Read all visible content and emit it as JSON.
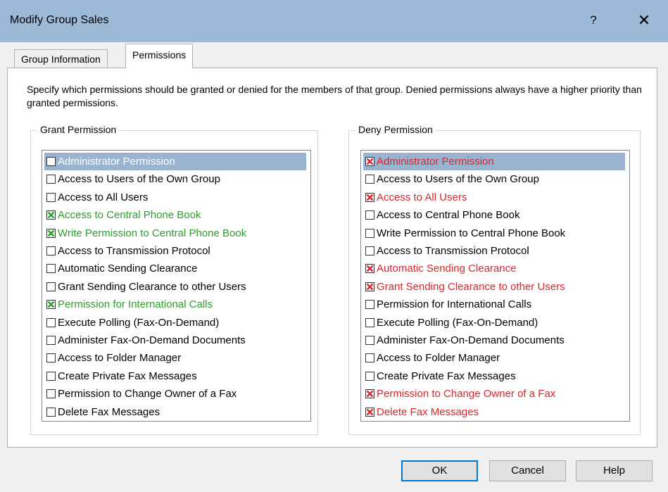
{
  "window": {
    "title": "Modify Group Sales",
    "help_glyph": "?",
    "close_glyph": "✕"
  },
  "tabs": [
    {
      "label": "Group Information",
      "active": false
    },
    {
      "label": "Permissions",
      "active": true
    }
  ],
  "description": "Specify which permissions should be granted or denied for the members of that group. Denied permissions always have a higher priority than granted permissions.",
  "grant": {
    "title": "Grant Permission",
    "items": [
      {
        "label": "Administrator Permission",
        "checked": false,
        "selected": true
      },
      {
        "label": "Access to Users of the Own Group",
        "checked": false
      },
      {
        "label": "Access to All Users",
        "checked": false
      },
      {
        "label": "Access to Central Phone Book",
        "checked": true
      },
      {
        "label": "Write Permission to Central Phone Book",
        "checked": true
      },
      {
        "label": "Access to Transmission Protocol",
        "checked": false
      },
      {
        "label": "Automatic Sending Clearance",
        "checked": false
      },
      {
        "label": "Grant Sending Clearance to other Users",
        "checked": false
      },
      {
        "label": "Permission for International Calls",
        "checked": true
      },
      {
        "label": "Execute Polling (Fax-On-Demand)",
        "checked": false
      },
      {
        "label": "Administer Fax-On-Demand Documents",
        "checked": false
      },
      {
        "label": "Access to Folder Manager",
        "checked": false
      },
      {
        "label": "Create Private Fax Messages",
        "checked": false
      },
      {
        "label": "Permission to Change Owner of a Fax",
        "checked": false
      },
      {
        "label": "Delete Fax Messages",
        "checked": false
      }
    ]
  },
  "deny": {
    "title": "Deny Permission",
    "items": [
      {
        "label": "Administrator Permission",
        "checked": true,
        "selected": true
      },
      {
        "label": "Access to Users of the Own Group",
        "checked": false
      },
      {
        "label": "Access to All Users",
        "checked": true
      },
      {
        "label": "Access to Central Phone Book",
        "checked": false
      },
      {
        "label": "Write Permission to Central Phone Book",
        "checked": false
      },
      {
        "label": "Access to Transmission Protocol",
        "checked": false
      },
      {
        "label": "Automatic Sending Clearance",
        "checked": true
      },
      {
        "label": "Grant Sending Clearance to other Users",
        "checked": true
      },
      {
        "label": "Permission for International Calls",
        "checked": false
      },
      {
        "label": "Execute Polling (Fax-On-Demand)",
        "checked": false
      },
      {
        "label": "Administer Fax-On-Demand Documents",
        "checked": false
      },
      {
        "label": "Access to Folder Manager",
        "checked": false
      },
      {
        "label": "Create Private Fax Messages",
        "checked": false
      },
      {
        "label": "Permission to Change Owner of a Fax",
        "checked": true
      },
      {
        "label": "Delete Fax Messages",
        "checked": true
      }
    ]
  },
  "buttons": {
    "ok": "OK",
    "cancel": "Cancel",
    "help": "Help"
  },
  "colors": {
    "grant": "#2e9c2e",
    "deny": "#d9262b",
    "titlebar": "#9db9d8",
    "selection": "#99b4d1"
  }
}
